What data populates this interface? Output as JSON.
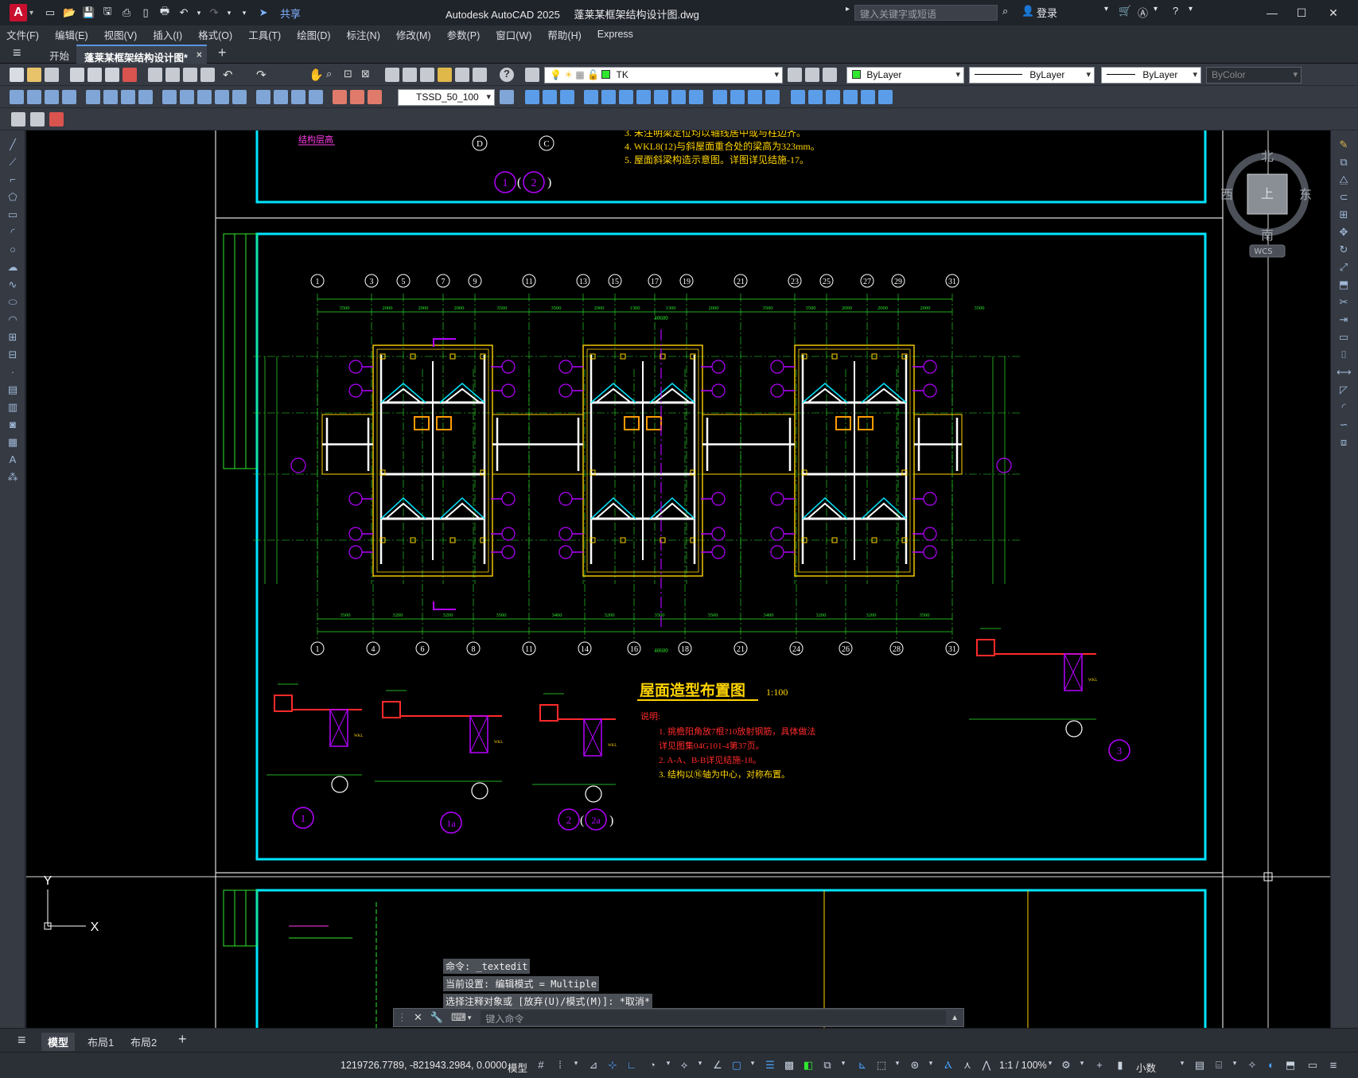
{
  "app": {
    "logo": "A",
    "title": "Autodesk AutoCAD 2025",
    "filename": "蓬莱某框架结构设计图.dwg",
    "share_label": "共享",
    "search_placeholder": "键入关键字或短语",
    "login_label": "登录"
  },
  "menu": {
    "items": [
      "文件(F)",
      "编辑(E)",
      "视图(V)",
      "插入(I)",
      "格式(O)",
      "工具(T)",
      "绘图(D)",
      "标注(N)",
      "修改(M)",
      "参数(P)",
      "窗口(W)",
      "帮助(H)",
      "Express"
    ]
  },
  "tabs": {
    "start": "开始",
    "active": "蓬莱某框架结构设计图*",
    "close": "×",
    "add": "+"
  },
  "toolbar": {
    "layer_name": "TK",
    "layer_color": "#2ee82e",
    "color_combo": "ByLayer",
    "linetype_combo": "ByLayer",
    "lineweight_combo": "ByLayer",
    "plotstyle_combo": "ByColor",
    "dimstyle_combo": "TSSD_50_100"
  },
  "viewcube": {
    "north": "北",
    "south": "南",
    "east": "东",
    "west": "西",
    "top": "上",
    "wcs": "WCS"
  },
  "drawing": {
    "top_notes": [
      "3. 未注明梁定位均以轴线居中或与柱边齐。",
      "4. WKL8(12)与斜屋面重合处的梁高为323mm。",
      "5. 屋面斜梁构造示意图。详图详见结施-17。"
    ],
    "top_label": "结构层高",
    "top_axis_labels": [
      "D",
      "C"
    ],
    "top_detail_marks": [
      "1",
      "2"
    ],
    "axis_top": [
      "1",
      "3",
      "5",
      "7",
      "9",
      "11",
      "13",
      "15",
      "17",
      "19",
      "21",
      "23",
      "25",
      "27",
      "29",
      "31"
    ],
    "axis_bottom": [
      "1",
      "4",
      "6",
      "8",
      "11",
      "14",
      "16",
      "18",
      "21",
      "24",
      "26",
      "28",
      "31"
    ],
    "dims_top": [
      "3500",
      "2000",
      "2000",
      "2000",
      "3500",
      "3500",
      "2000",
      "1300",
      "1300",
      "2000",
      "3500",
      "3500",
      "2000",
      "2000",
      "2000",
      "3500"
    ],
    "dims_bottom": [
      "3500",
      "3200",
      "3200",
      "3500",
      "3400",
      "3200",
      "3500",
      "3500",
      "3400",
      "3200",
      "3200",
      "3500"
    ],
    "overall_dim": "40600",
    "plan_title": "屋面造型布置图",
    "plan_scale": "1:100",
    "notes_heading": "说明:",
    "notes": [
      "1. 挑檐阳角放7根?10放射钢筋，具体做法",
      "详见图集04G101-4第37页。",
      "2. A-A、B-B详见结施-18。",
      "3. 结构以⑯轴为中心，对称布置。"
    ],
    "detail_marks": [
      "1",
      "1a",
      "2",
      "2a",
      "3"
    ],
    "wkl_label": "WKL"
  },
  "ucs": {
    "x_label": "X",
    "y_label": "Y"
  },
  "command": {
    "history": [
      "命令: _textedit",
      "当前设置: 编辑模式 = Multiple",
      "选择注释对象或 [放弃(U)/模式(M)]: *取消*"
    ],
    "placeholder": "键入命令"
  },
  "layout_tabs": [
    "模型",
    "布局1",
    "布局2"
  ],
  "status": {
    "coords": "1219726.7789, -821943.2984, 0.0000",
    "model": "模型",
    "scale": "1:1 / 100%",
    "units": "小数"
  }
}
